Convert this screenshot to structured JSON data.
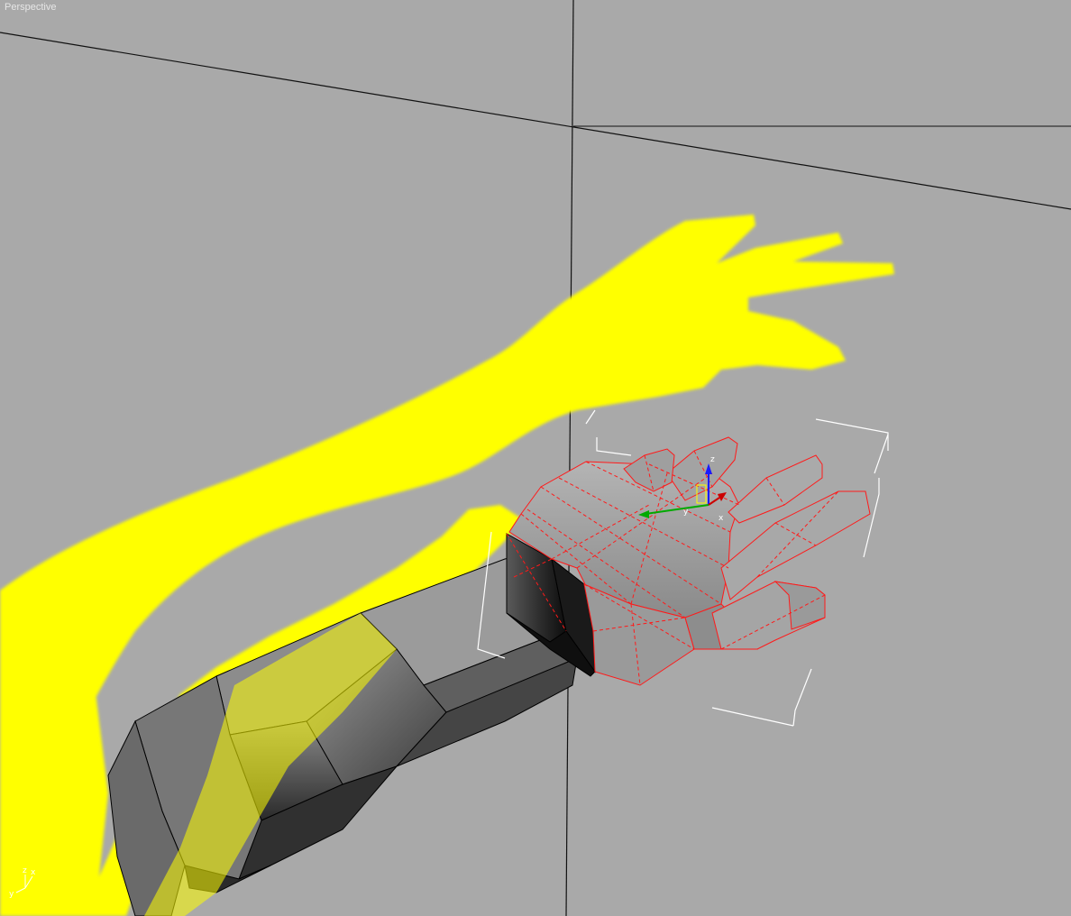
{
  "viewport": {
    "label": "Perspective"
  },
  "colors": {
    "background": "#a9a9a9",
    "grid_line": "#111111",
    "reference_image": "#ffff00",
    "selection_wire": "#ff1a1a",
    "mesh_edge": "#000000",
    "bounding_box": "#ffffff"
  },
  "view_cube": {
    "z": "z",
    "y": "y",
    "x": "x"
  },
  "gizmo": {
    "x": "x",
    "y": "y",
    "z": "z"
  }
}
